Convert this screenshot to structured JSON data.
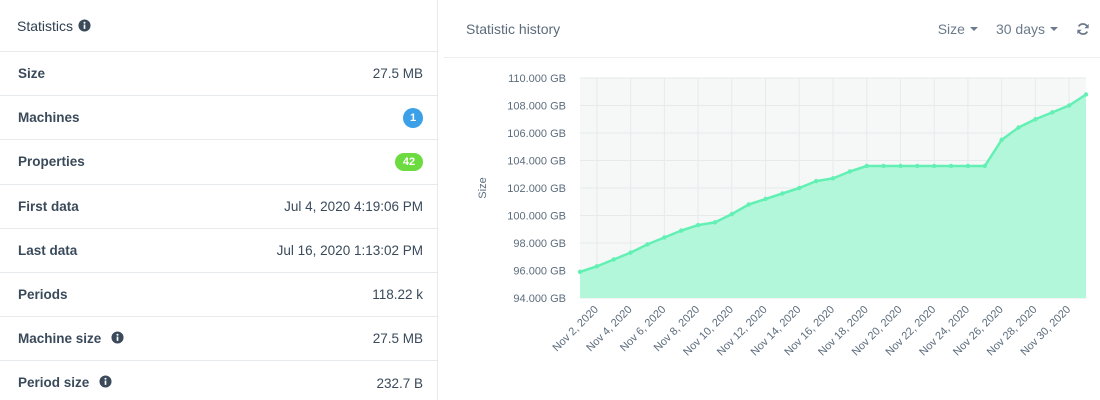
{
  "stats": {
    "title": "Statistics",
    "rows": [
      {
        "label": "Size",
        "value": "27.5 MB"
      },
      {
        "label": "Machines",
        "badge": "1",
        "badge_color": "#3ba0e8"
      },
      {
        "label": "Properties",
        "badge": "42",
        "badge_color": "#6cdb3f"
      },
      {
        "label": "First data",
        "value": "Jul 4, 2020 4:19:06 PM"
      },
      {
        "label": "Last data",
        "value": "Jul 16, 2020 1:13:02 PM"
      },
      {
        "label": "Periods",
        "value": "118.22 k"
      },
      {
        "label": "Machine size",
        "value": "27.5 MB",
        "info": true
      },
      {
        "label": "Period size",
        "value": "232.7 B",
        "info": true
      }
    ]
  },
  "history": {
    "title": "Statistic history",
    "metric_dropdown": "Size",
    "range_dropdown": "30 days",
    "refresh_icon": "refresh-icon"
  },
  "chart_data": {
    "type": "area",
    "ylabel": "Size",
    "xlabel": "",
    "ylim": [
      94,
      110
    ],
    "y_ticks": [
      "94.000 GB",
      "96.000 GB",
      "98.000 GB",
      "100.000 GB",
      "102.000 GB",
      "104.000 GB",
      "106.000 GB",
      "108.000 GB",
      "110.000 GB"
    ],
    "x_ticks": [
      "Nov 2, 2020",
      "Nov 4, 2020",
      "Nov 6, 2020",
      "Nov 8, 2020",
      "Nov 10, 2020",
      "Nov 12, 2020",
      "Nov 14, 2020",
      "Nov 16, 2020",
      "Nov 18, 2020",
      "Nov 20, 2020",
      "Nov 22, 2020",
      "Nov 24, 2020",
      "Nov 26, 2020",
      "Nov 28, 2020",
      "Nov 30, 2020"
    ],
    "x_range": [
      "2020-11-01",
      "2020-12-01"
    ],
    "color": "#62f0b4",
    "fill": "#b2f7d9",
    "series": [
      {
        "x": [
          "2020-11-01",
          "2020-11-02",
          "2020-11-03",
          "2020-11-04",
          "2020-11-05",
          "2020-11-06",
          "2020-11-07",
          "2020-11-08",
          "2020-11-09",
          "2020-11-10",
          "2020-11-11",
          "2020-11-12",
          "2020-11-13",
          "2020-11-14",
          "2020-11-15",
          "2020-11-16",
          "2020-11-17",
          "2020-11-18",
          "2020-11-19",
          "2020-11-20",
          "2020-11-21",
          "2020-11-22",
          "2020-11-23",
          "2020-11-24",
          "2020-11-25",
          "2020-11-26",
          "2020-11-27",
          "2020-11-28",
          "2020-11-29",
          "2020-11-30",
          "2020-12-01"
        ],
        "values": [
          95.9,
          96.3,
          96.8,
          97.3,
          97.9,
          98.4,
          98.9,
          99.3,
          99.5,
          100.1,
          100.8,
          101.2,
          101.6,
          102.0,
          102.5,
          102.7,
          103.2,
          103.6,
          103.6,
          103.6,
          103.6,
          103.6,
          103.6,
          103.6,
          103.6,
          105.5,
          106.4,
          107.0,
          107.5,
          108.0,
          108.8
        ]
      }
    ]
  }
}
